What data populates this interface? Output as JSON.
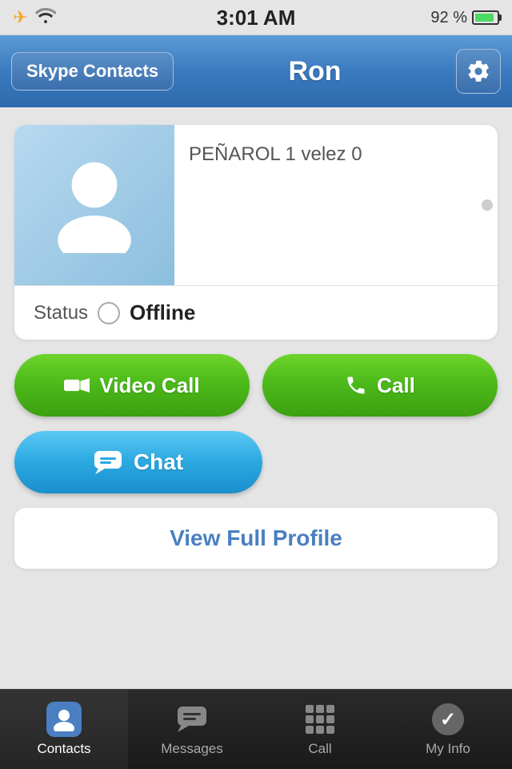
{
  "statusBar": {
    "time": "3:01 AM",
    "battery": "92 %"
  },
  "navBar": {
    "backButton": "Skype Contacts",
    "title": "Ron",
    "settingsLabel": "settings"
  },
  "profileCard": {
    "statusMessage": "PEÑAROL 1 velez 0",
    "statusLabel": "Status",
    "statusValue": "Offline"
  },
  "buttons": {
    "videoCall": "Video Call",
    "call": "Call",
    "chat": "Chat",
    "viewFullProfile": "View Full Profile"
  },
  "tabBar": {
    "contacts": "Contacts",
    "messages": "Messages",
    "call": "Call",
    "myInfo": "My Info"
  }
}
